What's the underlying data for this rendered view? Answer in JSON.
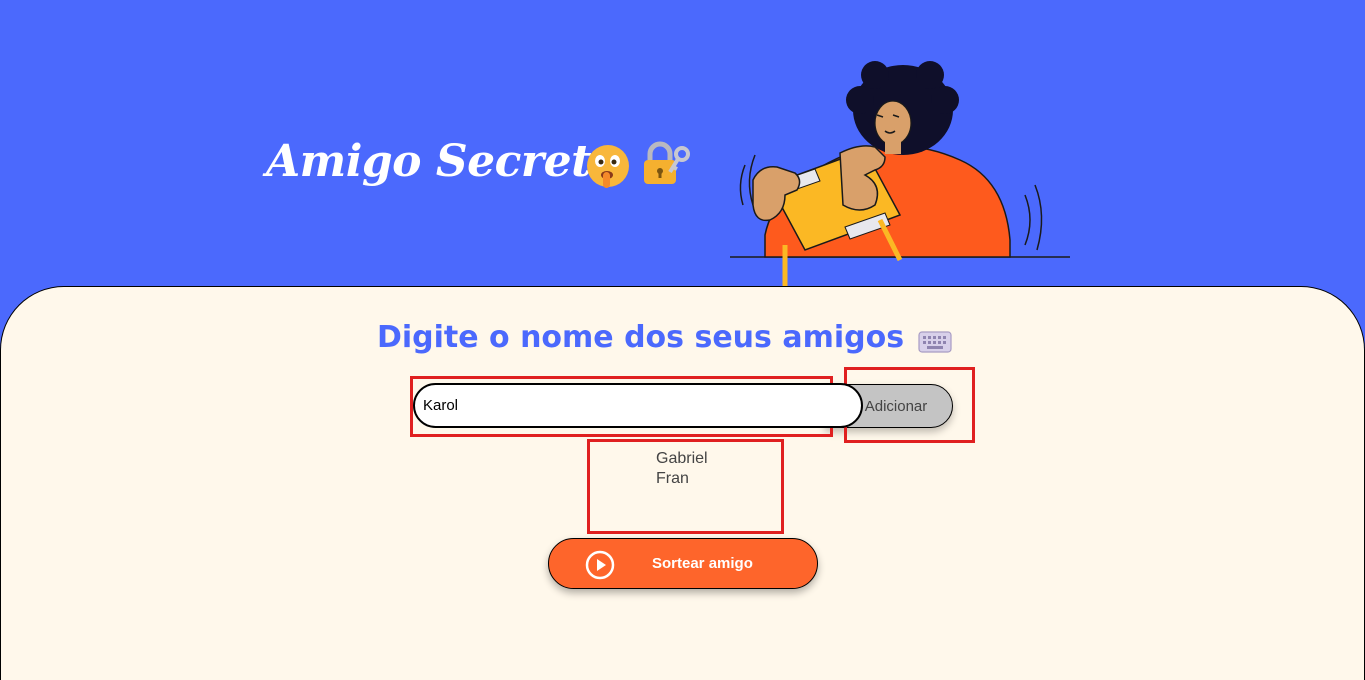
{
  "header": {
    "title": "Amigo Secreto",
    "icons": [
      "shushing-face-emoji-icon",
      "locked-with-key-emoji-icon"
    ],
    "illustration": "person-playing-handheld-console-illustration"
  },
  "main": {
    "section_title": "Digite o nome dos seus amigos",
    "section_icon": "keyboard-icon",
    "name_input": {
      "value": "Karol",
      "placeholder": ""
    },
    "add_button_label": "Adicionar",
    "friends": [
      "Gabriel",
      "Fran"
    ],
    "draw_button_label": "Sortear amigo",
    "draw_button_icon": "play-circle-icon"
  },
  "colors": {
    "header_bg": "#4b69fd",
    "panel_bg": "#fff8eb",
    "accent_blue": "#4b69fd",
    "draw_button": "#fe652b",
    "add_button": "#c4c4c4",
    "annotation_red": "#e02020"
  }
}
